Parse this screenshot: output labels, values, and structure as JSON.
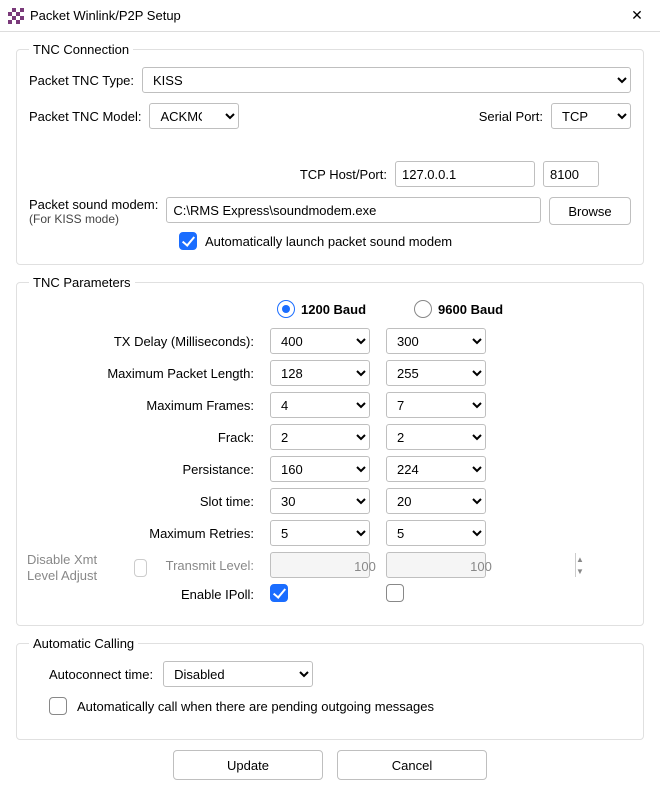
{
  "window": {
    "title": "Packet Winlink/P2P Setup"
  },
  "tnc_connection": {
    "legend": "TNC Connection",
    "type_label": "Packet TNC Type:",
    "type_value": "KISS",
    "model_label": "Packet TNC Model:",
    "model_value": "ACKMODE",
    "serial_port_label": "Serial Port:",
    "serial_port_value": "TCP",
    "tcp_label": "TCP Host/Port:",
    "tcp_host": "127.0.0.1",
    "tcp_port": "8100",
    "sound_modem_label": "Packet sound modem:",
    "sound_modem_note": "(For KISS mode)",
    "sound_modem_path": "C:\\RMS Express\\soundmodem.exe",
    "browse_label": "Browse",
    "auto_launch_label": "Automatically launch packet sound modem"
  },
  "tnc_parameters": {
    "legend": "TNC Parameters",
    "baud1200": "1200 Baud",
    "baud9600": "9600 Baud",
    "rows": [
      {
        "label": "TX Delay (Milliseconds):",
        "v1": "400",
        "v2": "300"
      },
      {
        "label": "Maximum Packet Length:",
        "v1": "128",
        "v2": "255"
      },
      {
        "label": "Maximum Frames:",
        "v1": "4",
        "v2": "7"
      },
      {
        "label": "Frack:",
        "v1": "2",
        "v2": "2"
      },
      {
        "label": "Persistance:",
        "v1": "160",
        "v2": "224"
      },
      {
        "label": "Slot time:",
        "v1": "30",
        "v2": "20"
      },
      {
        "label": "Maximum Retries:",
        "v1": "5",
        "v2": "5"
      }
    ],
    "transmit_level_label": "Transmit Level:",
    "transmit_level_v1": "100",
    "transmit_level_v2": "100",
    "disable_xmt_label": "Disable Xmt Level Adjust",
    "enable_ipoll_label": "Enable IPoll:"
  },
  "auto_calling": {
    "legend": "Automatic Calling",
    "autoconnect_label": "Autoconnect time:",
    "autoconnect_value": "Disabled",
    "auto_call_label": "Automatically call when there are pending outgoing messages"
  },
  "buttons": {
    "update": "Update",
    "cancel": "Cancel"
  }
}
